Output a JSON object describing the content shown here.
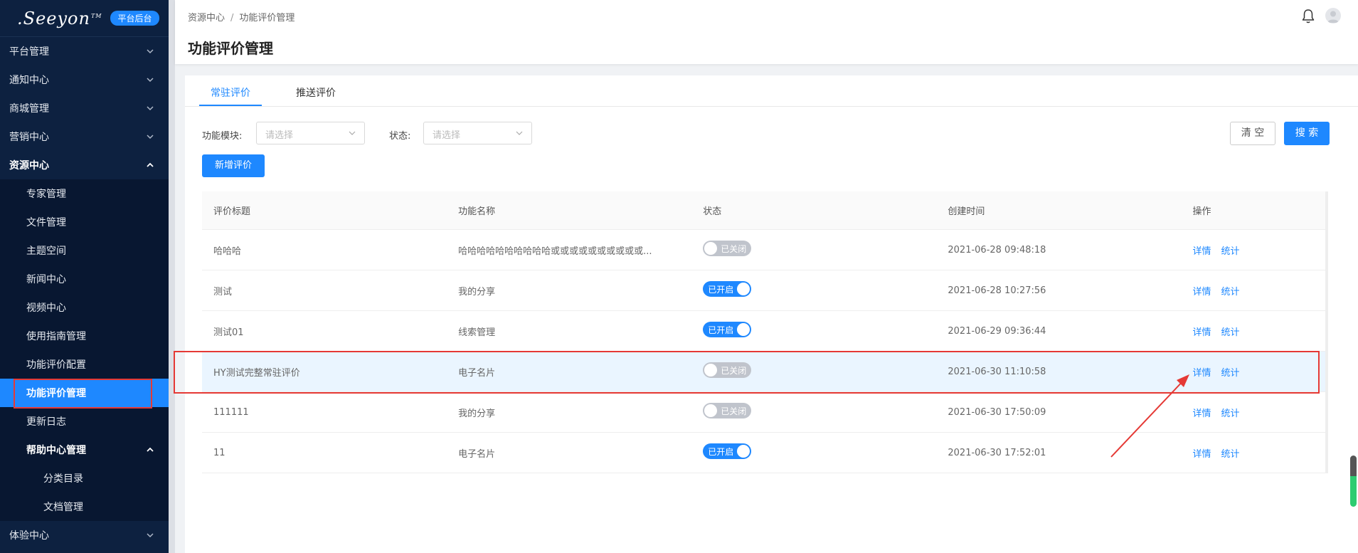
{
  "sidebar": {
    "logo_text": ".Seeyon",
    "logo_tm": "TM",
    "platform_badge": "平台后台",
    "items": [
      {
        "label": "平台管理"
      },
      {
        "label": "通知中心"
      },
      {
        "label": "商城管理"
      },
      {
        "label": "营销中心"
      },
      {
        "label": "资源中心"
      }
    ],
    "resource_sub": [
      {
        "label": "专家管理"
      },
      {
        "label": "文件管理"
      },
      {
        "label": "主题空间"
      },
      {
        "label": "新闻中心"
      },
      {
        "label": "视频中心"
      },
      {
        "label": "使用指南管理"
      },
      {
        "label": "功能评价配置"
      },
      {
        "label": "功能评价管理"
      },
      {
        "label": "更新日志"
      },
      {
        "label": "帮助中心管理"
      }
    ],
    "help_sub": [
      {
        "label": "分类目录"
      },
      {
        "label": "文档管理"
      }
    ],
    "bottom_item": {
      "label": "体验中心"
    }
  },
  "header": {
    "breadcrumb": [
      "资源中心",
      "功能评价管理"
    ],
    "breadcrumb_sep": "/",
    "title": "功能评价管理"
  },
  "tabs": [
    {
      "label": "常驻评价",
      "active": true
    },
    {
      "label": "推送评价",
      "active": false
    }
  ],
  "filters": {
    "module_label": "功能模块:",
    "module_placeholder": "请选择",
    "status_label": "状态:",
    "status_placeholder": "请选择",
    "clear_label": "清 空",
    "search_label": "搜 索",
    "new_label": "新增评价"
  },
  "table": {
    "columns": [
      "评价标题",
      "功能名称",
      "状态",
      "创建时间",
      "操作"
    ],
    "rows": [
      {
        "title": "哈哈哈",
        "feature": "哈哈哈哈哈哈哈哈哈哈或或或或或或或或或或...",
        "status": "已关闭",
        "on": false,
        "created": "2021-06-28 09:48:18"
      },
      {
        "title": "测试",
        "feature": "我的分享",
        "status": "已开启",
        "on": true,
        "created": "2021-06-28 10:27:56"
      },
      {
        "title": "测试01",
        "feature": "线索管理",
        "status": "已开启",
        "on": true,
        "created": "2021-06-29 09:36:44"
      },
      {
        "title": "HY测试完整常驻评价",
        "feature": "电子名片",
        "status": "已关闭",
        "on": false,
        "created": "2021-06-30 11:10:58"
      },
      {
        "title": "111111",
        "feature": "我的分享",
        "status": "已关闭",
        "on": false,
        "created": "2021-06-30 17:50:09"
      },
      {
        "title": "11",
        "feature": "电子名片",
        "status": "已开启",
        "on": true,
        "created": "2021-06-30 17:52:01"
      }
    ],
    "action_detail": "详情",
    "action_stats": "统计"
  },
  "colors": {
    "sidebar_bg": "#0d2140",
    "accent": "#1e88ff",
    "annotation": "#e53935"
  }
}
